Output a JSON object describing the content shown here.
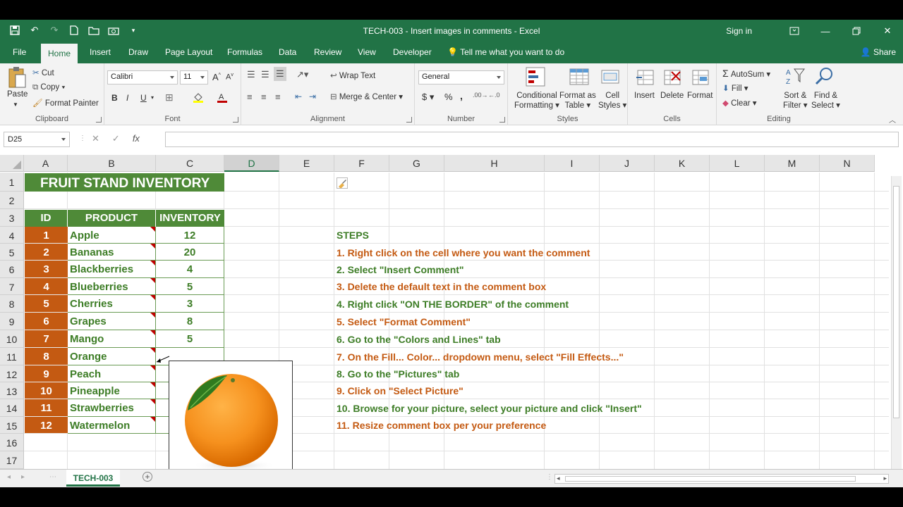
{
  "window": {
    "title": "TECH-003 - Insert images in comments  -  Excel",
    "signin": "Sign in"
  },
  "tabs": [
    "File",
    "Home",
    "Insert",
    "Draw",
    "Page Layout",
    "Formulas",
    "Data",
    "Review",
    "View",
    "Developer"
  ],
  "tell_me": "Tell me what you want to do",
  "share": "Share",
  "ribbon": {
    "clipboard": {
      "label": "Clipboard",
      "paste": "Paste",
      "cut": "Cut",
      "copy": "Copy",
      "format_painter": "Format Painter"
    },
    "font": {
      "label": "Font",
      "name": "Calibri",
      "size": "11",
      "bold": "B",
      "italic": "I",
      "underline": "U"
    },
    "alignment": {
      "label": "Alignment",
      "wrap": "Wrap Text",
      "merge": "Merge & Center"
    },
    "number": {
      "label": "Number",
      "format": "General",
      "currency": "$",
      "percent": "%",
      "comma": ","
    },
    "styles": {
      "label": "Styles",
      "cond": "Conditional",
      "cond2": "Formatting",
      "table": "Format as",
      "table2": "Table",
      "cell": "Cell",
      "cell2": "Styles"
    },
    "cells": {
      "label": "Cells",
      "insert": "Insert",
      "delete": "Delete",
      "format": "Format"
    },
    "editing": {
      "label": "Editing",
      "autosum": "AutoSum",
      "fill": "Fill",
      "clear": "Clear",
      "sort": "Sort &",
      "sort2": "Filter",
      "find": "Find &",
      "find2": "Select"
    }
  },
  "formula_bar": {
    "name_box": "D25",
    "cancel": "✕",
    "enter": "✓",
    "fx": "fx",
    "value": ""
  },
  "columns": [
    "A",
    "B",
    "C",
    "D",
    "E",
    "F",
    "G",
    "H",
    "I",
    "J",
    "K",
    "L",
    "M",
    "N"
  ],
  "rows": [
    "1",
    "2",
    "3",
    "4",
    "5",
    "6",
    "7",
    "8",
    "9",
    "10",
    "11",
    "12",
    "13",
    "14",
    "15",
    "16",
    "17"
  ],
  "sheet": {
    "title": "FRUIT STAND INVENTORY",
    "headers": {
      "id": "ID",
      "product": "PRODUCT",
      "inventory": "INVENTORY"
    },
    "items": [
      {
        "id": "1",
        "product": "Apple",
        "inventory": "12"
      },
      {
        "id": "2",
        "product": "Bananas",
        "inventory": "20"
      },
      {
        "id": "3",
        "product": "Blackberries",
        "inventory": "4"
      },
      {
        "id": "4",
        "product": "Blueberries",
        "inventory": "5"
      },
      {
        "id": "5",
        "product": "Cherries",
        "inventory": "3"
      },
      {
        "id": "6",
        "product": "Grapes",
        "inventory": "8"
      },
      {
        "id": "7",
        "product": "Mango",
        "inventory": "5"
      },
      {
        "id": "8",
        "product": "Orange",
        "inventory": ""
      },
      {
        "id": "9",
        "product": "Peach",
        "inventory": ""
      },
      {
        "id": "10",
        "product": "Pineapple",
        "inventory": ""
      },
      {
        "id": "11",
        "product": "Strawberries",
        "inventory": ""
      },
      {
        "id": "12",
        "product": "Watermelon",
        "inventory": ""
      }
    ],
    "steps_title": "STEPS",
    "steps": [
      "1. Right click on the cell where you want the comment",
      "2. Select \"Insert Comment\"",
      "3. Delete the default text in the comment box",
      "4. Right click \"ON THE BORDER\" of the comment",
      "5. Select \"Format Comment\"",
      "6. Go to the \"Colors and Lines\" tab",
      "7. On the Fill... Color... dropdown menu, select \"Fill Effects...\"",
      "8. Go to the \"Pictures\" tab",
      "9. Click on \"Select Picture\"",
      "10. Browse for your picture, select your picture and click \"Insert\"",
      "11. Resize comment box per your preference"
    ]
  },
  "sheet_tab": "TECH-003",
  "colors": {
    "excel_green": "#217346",
    "title_green": "#4f8a38",
    "id_orange": "#c45a12",
    "text_green": "#3d7d26",
    "comment_red": "#c00000"
  }
}
